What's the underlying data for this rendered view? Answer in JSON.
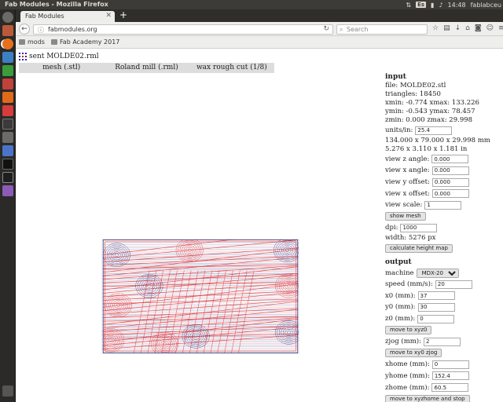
{
  "window": {
    "title": "Fab Modules - Mozilla Firefox"
  },
  "topbar": {
    "keyboard": "Es",
    "time": "14:48",
    "user": "fablabceu"
  },
  "browser": {
    "tab_label": "Fab Modules",
    "url": "fabmodules.org",
    "search_placeholder": "Search",
    "bookmarks": [
      "mods",
      "Fab Academy 2017"
    ]
  },
  "page": {
    "status": "sent MOLDE02.rml",
    "stages": [
      "mesh (.stl)",
      "Roland mill (.rml)",
      "wax rough cut (1/8)"
    ]
  },
  "input": {
    "heading": "input",
    "file": "file: MOLDE02.stl",
    "triangles": "triangles: 18450",
    "xrange": "xmin: -0.774 xmax: 133.226",
    "yrange": "ymin: -0.543 ymax: 78.457",
    "zrange": "zmin: 0.000 zmax: 29.998",
    "units_label": "units/in:",
    "units_value": "25.4",
    "size_mm": "134.000 x 79.000 x 29.998 mm",
    "size_in": "5.276 x 3.110 x 1.181 in",
    "view_z_label": "view z angle:",
    "view_z_value": "0.000",
    "view_x_label": "view x angle:",
    "view_x_value": "0.000",
    "view_y_off_label": "view y offset:",
    "view_y_off_value": "0.000",
    "view_x_off_label": "view x offset:",
    "view_x_off_value": "0.000",
    "view_scale_label": "view scale:",
    "view_scale_value": "1",
    "show_mesh": "show mesh",
    "dpi_label": "dpi:",
    "dpi_value": "1000",
    "width": "width: 5276 px",
    "calc_height": "calculate height map"
  },
  "output": {
    "heading": "output",
    "machine_label": "machine",
    "machine_value": "MDX-20",
    "speed_label": "speed (mm/s):",
    "speed_value": "20",
    "x0_label": "x0 (mm):",
    "x0_value": "37",
    "y0_label": "y0 (mm):",
    "y0_value": "30",
    "z0_label": "z0 (mm):",
    "z0_value": "0",
    "move_xyz0": "move to xyz0",
    "zjog_label": "zjog (mm):",
    "zjog_value": "2",
    "move_xy0": "move to xy0 zjog",
    "xhome_label": "xhome (mm):",
    "xhome_value": "0",
    "yhome_label": "yhome (mm):",
    "yhome_value": "152.4",
    "zhome_label": "zhome (mm):",
    "zhome_value": "60.5",
    "move_home": "move to xyzhome and stop"
  },
  "colors": {
    "toolpath_red": "#e3262b",
    "toolpath_blue": "#2b2f7a",
    "launcher_bg": "#2b2a28",
    "topbar_bg": "#3c3b37"
  }
}
